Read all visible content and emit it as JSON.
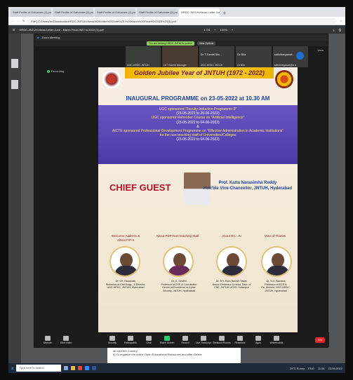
{
  "browser": {
    "tabs": [
      "Staff Profile of Galvanee (2).pdf",
      "Staff Profile of Galvanee (2).pdf",
      "Staff Profile of Galvanee (2).pdf",
      "Staff Profile of Galvanee (2).pdf",
      "HRDC JNTUH-News Letter Jun"
    ],
    "url": "File | C:/Users/hc/Downloads/HRDC-JNTUH-News%20Letter%20June%20-%20March%20Final%202022%20(1).pdf",
    "pdf_title": "HRDC-JNTUH-News Letter June - March Final 2022 to 2022 (1).pdf",
    "page_indicator": "1 /78",
    "zoom": "100%"
  },
  "zoom_window": {
    "title": "Zoom Meeting",
    "viewing_pill": "You are viewing HRDC JNTUH's screen",
    "view_options": "View Options",
    "view_label": "View",
    "recording": "Recording",
    "participants": [
      {
        "name": "UGC-HRDC JNTUH",
        "label": "UGC-HRDC JNTUH"
      },
      {
        "name": "Dr T Sambi Ma...",
        "label": "Dr T Sambi Manager"
      },
      {
        "name": "UGC-HRDC JNTUH",
        "label": "UGC-HRDC JNTUH"
      },
      {
        "name": "Dr Bila",
        "label": "Dr Bila"
      },
      {
        "name": "satishbegawat...",
        "label": "satishbegawat@cr.a"
      }
    ]
  },
  "poster": {
    "banner": "Golden Jubilee Year of JNTUH (1972 - 2022)",
    "inaugural": "INAUGURAL PROGRAMME on 23-05-2022 at 10.30 AM",
    "prog_lines": [
      {
        "t": "UGC sponsored \"Faculty Induction Programme-9\"",
        "y": true
      },
      {
        "t": "(23-05-2022 to 20-06-2022)",
        "y": false
      },
      {
        "t": "UGC sponsored Refresher Course on \"Artificial Intelligence\"",
        "y": true
      },
      {
        "t": "(23-05-2022 to 04-06-2022)",
        "y": false
      },
      {
        "t": "&",
        "y": false
      },
      {
        "t": "AICTE sponsored Professional Development Programme on \"Effective Administration in Academic Institutions\"",
        "y": true
      },
      {
        "t": "for the non-teaching staff of Universities/Colleges",
        "y": true
      },
      {
        "t": "(23-05-2022 to 04-06-2022)",
        "y": false
      }
    ],
    "chief_guest": "CHIEF GUEST",
    "guest_name": "Prof. Katta Narasimha Reddy",
    "guest_role": "Hon'ble Vice-Chancellor, JNTUH, Hyderabad",
    "roles": [
      {
        "lbl": "Welcome Address & About FIP-9",
        "name": "Dr. GK Viswanath\nProfessor of Civil Engg., & Director,\nUGC-HRDC, JNTUH, Hyderabad"
      },
      {
        "lbl": "About PDP-Non-teaching Staff",
        "name": "Dr. K. Sindhri\nProfessor of CSE & Coordinator\nCentre of Excellence in Cyber\nSecurity, JNTUH, Hyderabad"
      },
      {
        "lbl": "About RC - AI",
        "name": "Dr. B.V. Ram Naresh Yadav\nAssoc. Professor & Head, Dept. of\nCSE, JNTUH UCES, Sultanpur"
      },
      {
        "lbl": "Vote of Thanks",
        "name": "Dr. N.V. Ramana\nProfessor of ECE &\nCo. Director, UGC-HRDC,\nJNTUH, Hyderabad"
      }
    ]
  },
  "controls": [
    "Unmute",
    "Start Video",
    "Security",
    "Participants",
    "Chat",
    "Share Screen",
    "Record",
    "Live Transcript",
    "Breakout Rooms",
    "Reactions",
    "Apps",
    "Whiteboards"
  ],
  "end_label": "End",
  "pdf_text": [
    "all over the Country.",
    "b) To organize the online Open Educational Resources and offer Online"
  ],
  "taskbar": {
    "search": "Type here to search",
    "weather": "29°C Sunny",
    "lang": "ENG",
    "time": "11:54",
    "date": "23-05-2022"
  }
}
